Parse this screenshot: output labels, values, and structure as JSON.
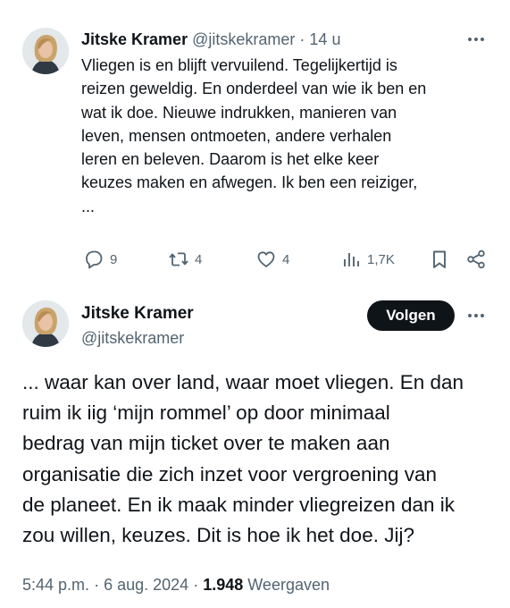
{
  "tweet1": {
    "name": "Jitske Kramer",
    "handle": "@jitskekramer",
    "separator": "·",
    "age": "14 u",
    "text": "Vliegen is en blijft vervuilend. Tegelijkertijd is\nreizen geweldig. En onderdeel van wie ik ben en\nwat ik doe. Nieuwe indrukken, manieren van\nleven, mensen ontmoeten, andere verhalen\nleren en beleven. Daarom is het elke keer\nkeuzes maken en afwegen. Ik ben een reiziger,\n...",
    "actions": {
      "replies": "9",
      "reposts": "4",
      "likes": "4",
      "views": "1,7K"
    }
  },
  "tweet2": {
    "name": "Jitske Kramer",
    "handle": "@jitskekramer",
    "follow_label": "Volgen",
    "text": "... waar kan over land, waar moet vliegen. En dan\nruim ik iig ‘mijn rommel’ op door minimaal\nbedrag van mijn ticket over te maken aan\norganisatie die zich inzet voor vergroening van\nde planeet. En ik maak minder vliegreizen dan ik\nzou willen, keuzes. Dit is hoe ik het doe. Jij?",
    "time": "5:44 p.m.",
    "separator": "·",
    "date": "6 aug. 2024",
    "views_count": "1.948",
    "views_label": "Weergaven"
  },
  "icons": {
    "reply": "reply-icon",
    "retweet": "retweet-icon",
    "like": "heart-icon",
    "views": "views-icon",
    "bookmark": "bookmark-icon",
    "share": "share-icon",
    "more": "more-icon"
  },
  "colors": {
    "text": "#0f1419",
    "muted": "#536471",
    "follow_bg": "#0f1419",
    "follow_text": "#ffffff"
  }
}
